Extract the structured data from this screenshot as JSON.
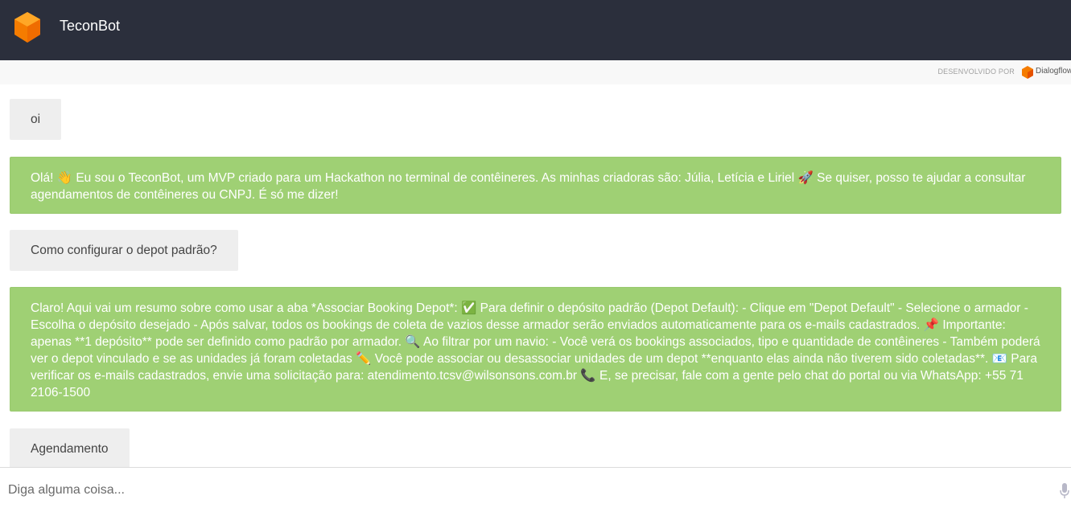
{
  "header": {
    "title": "TeconBot",
    "logo_icon": "cube-logo-icon",
    "bg_color": "#2b2f3c",
    "logo_color": "#f57c00"
  },
  "powered_by": {
    "label": "DESENVOLVIDO POR",
    "brand": "Dialogflow",
    "icon": "dialogflow-icon"
  },
  "messages": [
    {
      "role": "user",
      "text": "oi"
    },
    {
      "role": "bot",
      "text": "Olá! 👋 Eu sou o TeconBot, um MVP criado para um Hackathon no terminal de contêineres. As minhas criadoras são: Júlia, Letícia e Liriel 🚀 Se quiser, posso te ajudar a consultar agendamentos de contêineres ou CNPJ. É só me dizer!"
    },
    {
      "role": "user",
      "text": "Como configurar o depot padrão?"
    },
    {
      "role": "bot",
      "text": "Claro! Aqui vai um resumo sobre como usar a aba *Associar Booking Depot*: ✅ Para definir o depósito padrão (Depot Default): - Clique em \"Depot Default\" - Selecione o armador - Escolha o depósito desejado - Após salvar, todos os bookings de coleta de vazios desse armador serão enviados automaticamente para os e-mails cadastrados. 📌 Importante: apenas **1 depósito** pode ser definido como padrão por armador. 🔍 Ao filtrar por um navio: - Você verá os bookings associados, tipo e quantidade de contêineres - Também poderá ver o depot vinculado e se as unidades já foram coletadas ✏️ Você pode associar ou desassociar unidades de um depot **enquanto elas ainda não tiverem sido coletadas**. 📧 Para verificar os e-mails cadastrados, envie uma solicitação para: atendimento.tcsv@wilsonsons.com.br 📞 E, se precisar, fale com a gente pelo chat do portal ou via WhatsApp: +55 71 2106-1500"
    },
    {
      "role": "user",
      "text": "Agendamento"
    }
  ],
  "colors": {
    "bot_bubble": "#9fd074",
    "user_bubble": "#eeeeee"
  },
  "input": {
    "placeholder": "Diga alguma coisa...",
    "value": "",
    "mic_icon": "microphone-icon"
  }
}
